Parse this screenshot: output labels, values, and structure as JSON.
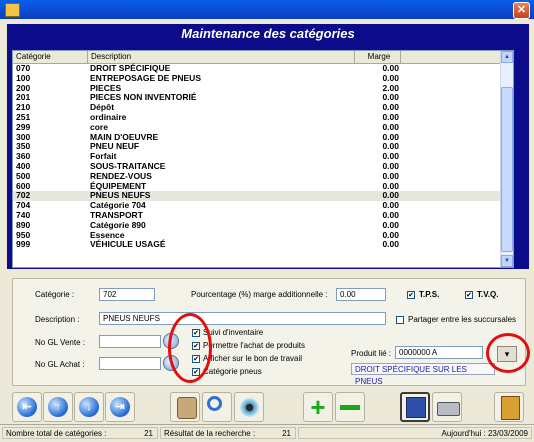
{
  "window": {
    "title": ""
  },
  "panel_title": "Maintenance des catégories",
  "list": {
    "headers": {
      "categorie": "Catégorie",
      "description": "Description",
      "marge": "Marge"
    },
    "rows": [
      {
        "code": "070",
        "description": "DROIT SPÉCIFIQUE",
        "marge": "0.00"
      },
      {
        "code": "100",
        "description": "ENTREPOSAGE DE PNEUS",
        "marge": "0.00"
      },
      {
        "code": "200",
        "description": "PIECES",
        "marge": "2.00"
      },
      {
        "code": "201",
        "description": "PIECES NON INVENTORIÉ",
        "marge": "0.00"
      },
      {
        "code": "210",
        "description": "Dépôt",
        "marge": "0.00"
      },
      {
        "code": "251",
        "description": "ordinaire",
        "marge": "0.00"
      },
      {
        "code": "299",
        "description": "core",
        "marge": "0.00"
      },
      {
        "code": "300",
        "description": "MAIN D'OEUVRE",
        "marge": "0.00"
      },
      {
        "code": "350",
        "description": "PNEU NEUF",
        "marge": "0.00"
      },
      {
        "code": "360",
        "description": "Forfait",
        "marge": "0.00"
      },
      {
        "code": "400",
        "description": "SOUS-TRAITANCE",
        "marge": "0.00"
      },
      {
        "code": "500",
        "description": "RENDEZ-VOUS",
        "marge": "0.00"
      },
      {
        "code": "600",
        "description": "ÉQUIPEMENT",
        "marge": "0.00"
      },
      {
        "code": "702",
        "description": "PNEUS NEUFS",
        "marge": "0.00"
      },
      {
        "code": "704",
        "description": "Catégorie 704",
        "marge": "0.00"
      },
      {
        "code": "740",
        "description": "TRANSPORT",
        "marge": "0.00"
      },
      {
        "code": "890",
        "description": "Catégorie 890",
        "marge": "0.00"
      },
      {
        "code": "950",
        "description": "Essence",
        "marge": "0.00"
      },
      {
        "code": "999",
        "description": "VÉHICULE USAGÉ",
        "marge": "0.00"
      }
    ],
    "selected_code": "702"
  },
  "form": {
    "categorie_label": "Catégorie :",
    "categorie_value": "702",
    "pourcentage_label": "Pourcentage (%) marge additionnelle :",
    "pourcentage_value": "0.00",
    "tps_label": "T.P.S.",
    "tvq_label": "T.V.Q.",
    "description_label": "Description :",
    "description_value": "PNEUS NEUFS",
    "partager_label": "Partager entre les succursales",
    "gl_vente_label": "No GL Vente :",
    "gl_achat_label": "No GL Achat :",
    "suivi_label": "Suivi d'inventaire",
    "permettre_label": "Permettre l'achat de produits",
    "afficher_label": "Afficher sur le bon de travail",
    "categorie_pneus_label": "Catégorie pneus",
    "produit_lie_label": "Produit lié :",
    "produit_lie_value": "0000000 A",
    "produit_lie_desc": "DROIT SPÉCIFIQUE SUR LES PNEUS"
  },
  "statusbar": {
    "total_label": "Nombre total de catégories :",
    "total_value": "21",
    "resultat_label": "Résultat de la recherche :",
    "resultat_value": "21",
    "date_label": "Aujourd'hui : 23/03/2009"
  },
  "colors": {
    "title_bg": "#0c0c8a",
    "circle": "#e01010",
    "list_bg": "#ffffff"
  },
  "icons": [
    "first-record-icon",
    "previous-record-icon",
    "next-record-icon",
    "last-record-icon",
    "lookup-icon",
    "search-icon",
    "view-icon",
    "add-icon",
    "remove-icon",
    "save-icon",
    "print-icon",
    "exit-icon"
  ]
}
